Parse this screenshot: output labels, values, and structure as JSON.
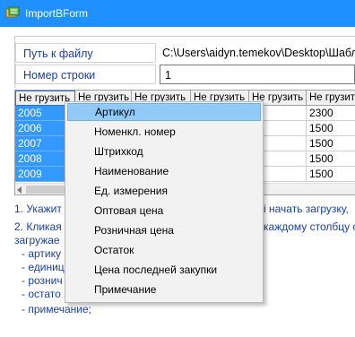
{
  "window": {
    "title": "ImportBForm"
  },
  "form": {
    "file_path_label": "Путь к файлу",
    "file_path_value": "C:\\Users\\aidyn.temekov\\Desktop\\Шаблон",
    "row_number_label": "Номер строки",
    "row_number_value": "1"
  },
  "grid": {
    "headers": [
      "Не грузить",
      "Не грузить",
      "Не грузить",
      "Не грузить",
      "Не грузить",
      "Не грузить"
    ],
    "first_column": [
      "2005",
      "2006",
      "2007",
      "2008",
      "2009"
    ],
    "last_column": [
      "2300",
      "1500",
      "1500",
      "1500",
      "1500"
    ]
  },
  "instructions": [
    "1. Укажит",
    "і начать загрузку,",
    "2. Кликая",
    "каждому столбцу со",
    "загружае",
    "- артику",
    "- единиц",
    "- рознич",
    "- остато",
    "- примечание;"
  ],
  "context_menu": {
    "items": [
      "Артикул",
      "Номенкл. номер",
      "Штрихкод",
      "Наименование",
      "Ед. измерения",
      "Оптовая цена",
      "Розничная цена",
      "Остаток",
      "Цена последней закупки",
      "Примечание"
    ],
    "highlighted_index": 0
  },
  "colors": {
    "titlebar": "#1e90ff",
    "selection": "#3399ff",
    "menu_highlight": "#91c9f7",
    "label_text": "#1a3ea8"
  }
}
